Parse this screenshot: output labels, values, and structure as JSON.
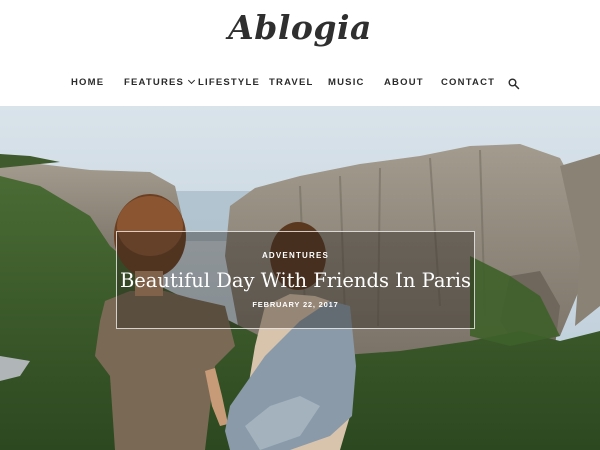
{
  "site": {
    "logo": "Ablogia"
  },
  "nav": {
    "items": [
      {
        "label": "HOME"
      },
      {
        "label": "FEATURES",
        "has_dropdown": true
      },
      {
        "label": "LIFESTYLE"
      },
      {
        "label": "TRAVEL"
      },
      {
        "label": "MUSIC"
      },
      {
        "label": "ABOUT"
      },
      {
        "label": "CONTACT"
      }
    ],
    "search_icon": "search-icon"
  },
  "featured_post": {
    "category": "ADVENTURES",
    "title": "Beautiful Day With Friends In Paris",
    "date": "FEBRUARY 22, 2017"
  },
  "colors": {
    "text": "#2b2b2b",
    "overlay": "#28221e",
    "sky": "#c9d7e0",
    "forest": "#3b5e2a",
    "rock": "#8e8577"
  }
}
